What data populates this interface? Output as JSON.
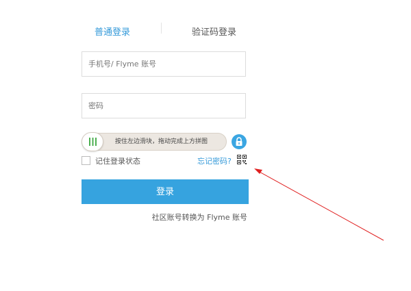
{
  "tabs": {
    "normal_login": "普通登录",
    "sms_login": "验证码登录"
  },
  "form": {
    "account_placeholder": "手机号/ Flyme 账号",
    "password_placeholder": "密码",
    "slider_hint": "按住左边滑块，拖动完成上方拼图",
    "remember_label": "记住登录状态",
    "forgot_link": "忘记密码?",
    "login_button": "登录",
    "convert_link": "社区账号转换为 Flyme 账号"
  },
  "icons": {
    "slider_knob": "drag-handle-icon",
    "lock": "lock-icon",
    "qr": "qr-code-icon",
    "annotation": "red-arrow-annotation"
  },
  "colors": {
    "accent": "#36a3df",
    "tab_active": "#3399d9",
    "knob_bars": "#4caf50",
    "annotation": "#e02020"
  }
}
